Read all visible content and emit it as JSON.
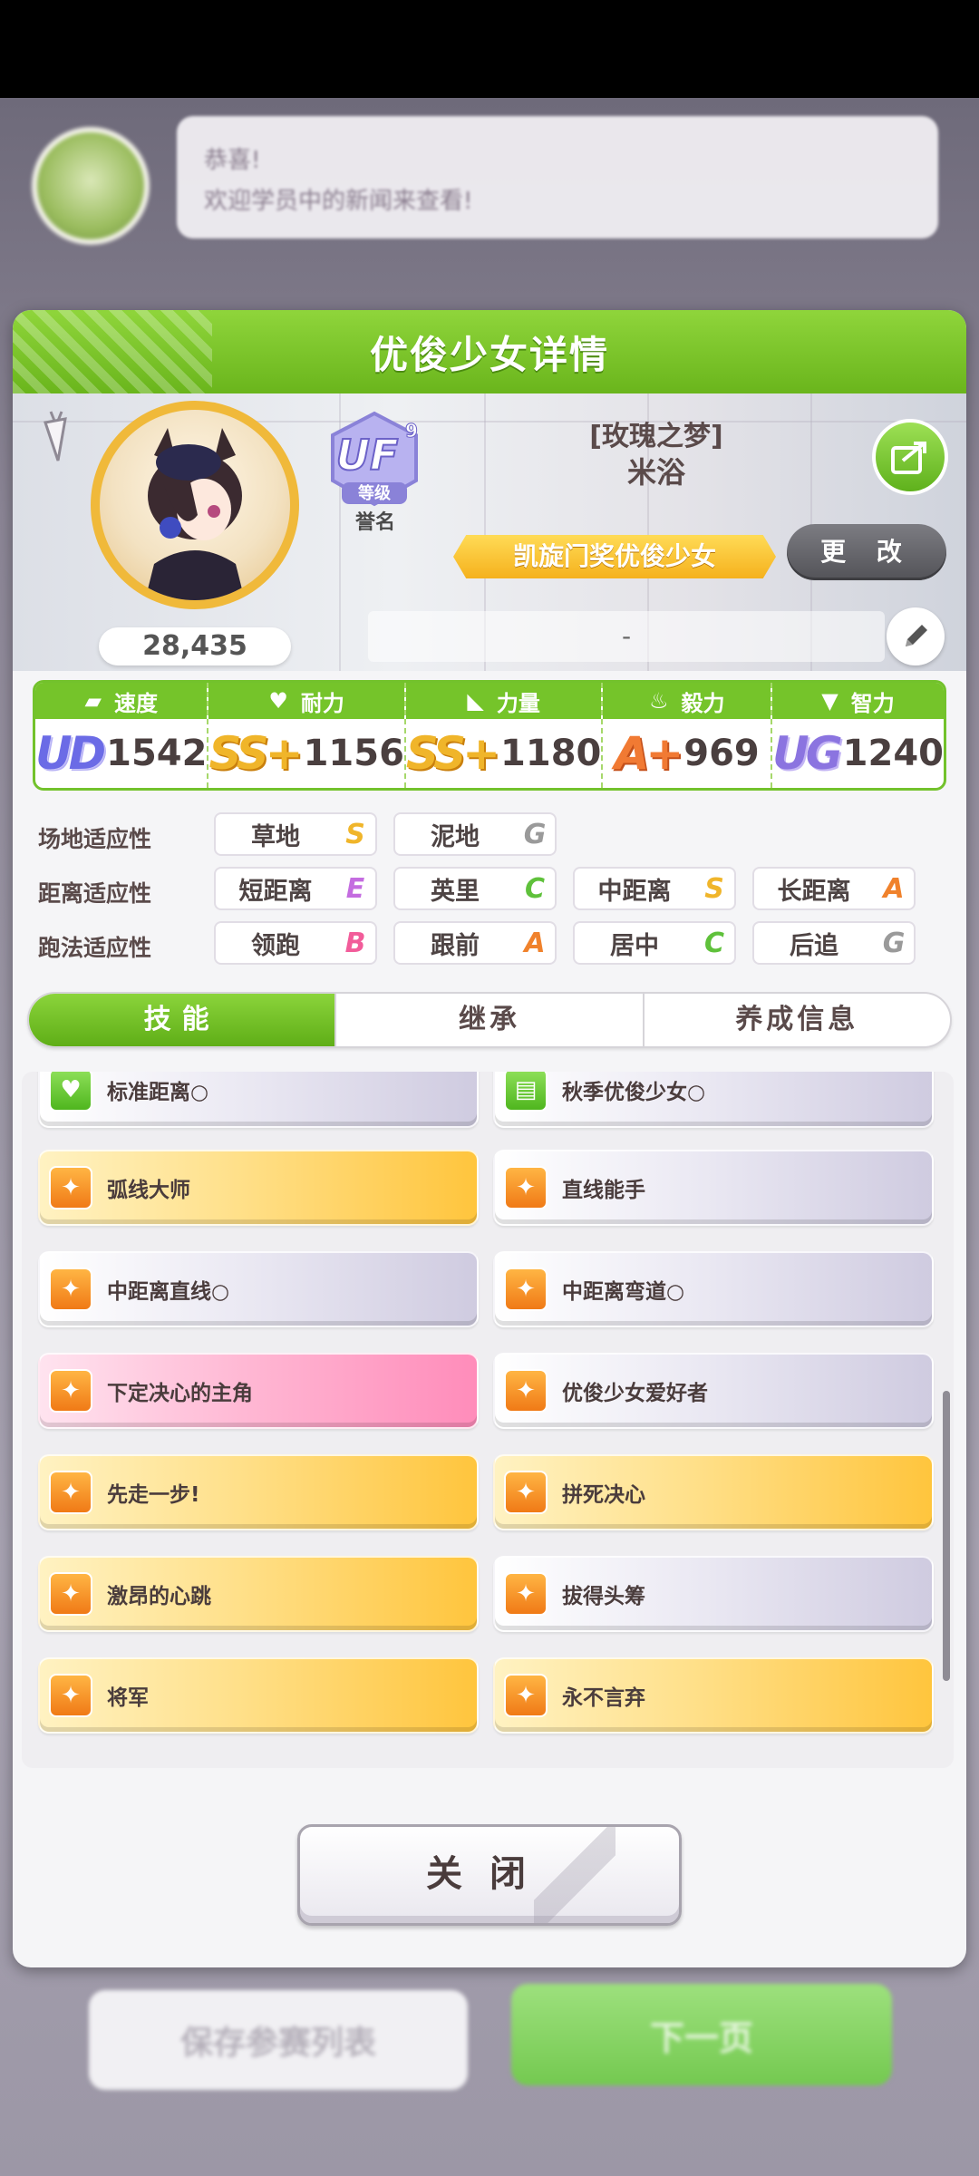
{
  "background": {
    "bubble_line1": "恭喜!",
    "bubble_line2": "欢迎学员中的新闻来查看!",
    "save_list_button": "保存参赛列表",
    "next_button": "下一页"
  },
  "dialog": {
    "title": "优俊少女详情",
    "profile": {
      "fans": "28,435",
      "rank_label": "誉名",
      "rank_badge_text": "UF",
      "rank_badge_num": "9",
      "rank_badge_sub": "等级",
      "title": "[玫瑰之梦]",
      "name": "米浴",
      "epithet": "凯旋门奖优俊少女",
      "change_button": "更 改",
      "comment": "-"
    },
    "stats": [
      {
        "label": "速度",
        "grade": "UD",
        "grade_num": "4",
        "value": "1542"
      },
      {
        "label": "耐力",
        "grade": "SS+",
        "value": "1156"
      },
      {
        "label": "力量",
        "grade": "SS+",
        "value": "1180"
      },
      {
        "label": "毅力",
        "grade": "A+",
        "value": "969"
      },
      {
        "label": "智力",
        "grade": "UG",
        "grade_num": "4",
        "value": "1240"
      }
    ],
    "aptitude": {
      "track_label": "场地适应性",
      "track": [
        {
          "name": "草地",
          "grade": "S"
        },
        {
          "name": "泥地",
          "grade": "G"
        }
      ],
      "distance_label": "距离适应性",
      "distance": [
        {
          "name": "短距离",
          "grade": "E"
        },
        {
          "name": "英里",
          "grade": "C"
        },
        {
          "name": "中距离",
          "grade": "S"
        },
        {
          "name": "长距离",
          "grade": "A"
        }
      ],
      "style_label": "跑法适应性",
      "style": [
        {
          "name": "领跑",
          "grade": "B"
        },
        {
          "name": "跟前",
          "grade": "A"
        },
        {
          "name": "居中",
          "grade": "C"
        },
        {
          "name": "后追",
          "grade": "G"
        }
      ]
    },
    "tabs": [
      "技能",
      "继承",
      "养成信息"
    ],
    "skills": [
      {
        "name": "标准距离○",
        "type": "normal",
        "icon": "heart-icon"
      },
      {
        "name": "秋季优俊少女○",
        "type": "normal",
        "icon": "card-icon"
      },
      {
        "name": "弧线大师",
        "type": "gold",
        "icon": "runner-icon"
      },
      {
        "name": "直线能手",
        "type": "normal",
        "icon": "runner-icon"
      },
      {
        "name": "中距离直线○",
        "type": "normal",
        "icon": "runner-icon"
      },
      {
        "name": "中距离弯道○",
        "type": "normal",
        "icon": "runner-icon"
      },
      {
        "name": "下定决心的主角",
        "type": "pink",
        "icon": "runner-icon"
      },
      {
        "name": "优俊少女爱好者",
        "type": "normal",
        "icon": "runner-icon"
      },
      {
        "name": "先走一步!",
        "type": "gold",
        "icon": "runner-icon"
      },
      {
        "name": "拼死决心",
        "type": "gold",
        "icon": "runner-icon"
      },
      {
        "name": "激昂的心跳",
        "type": "gold",
        "icon": "runner-icon"
      },
      {
        "name": "拔得头筹",
        "type": "normal",
        "icon": "runner-icon"
      },
      {
        "name": "将军",
        "type": "gold",
        "icon": "runner-icon"
      },
      {
        "name": "永不言弃",
        "type": "gold",
        "icon": "runner-icon"
      }
    ],
    "close_button": "关闭"
  }
}
